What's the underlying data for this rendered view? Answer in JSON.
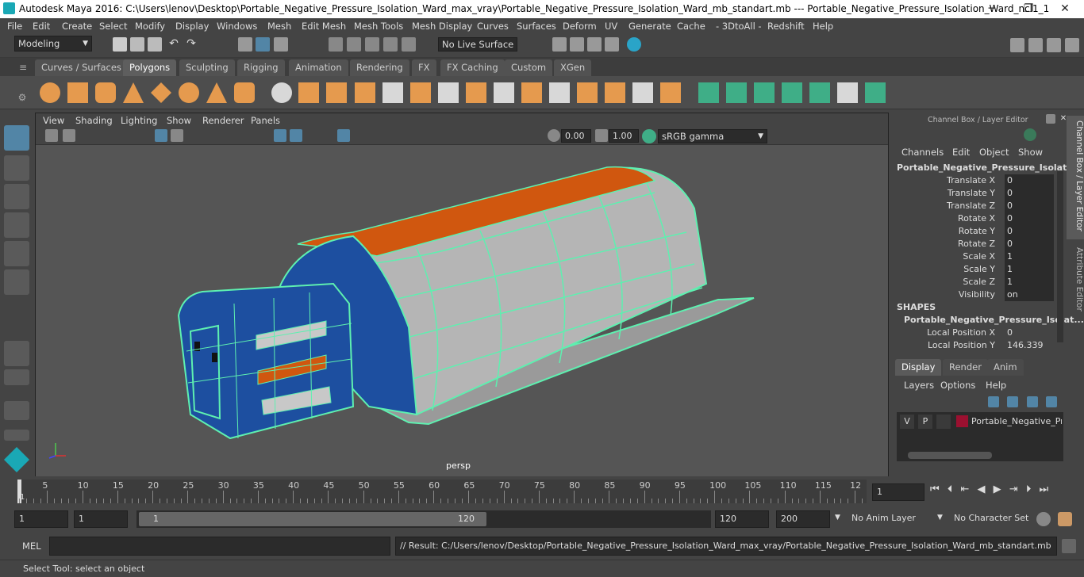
{
  "title": "Autodesk Maya 2016: C:\\Users\\lenov\\Desktop\\Portable_Negative_Pressure_Isolation_Ward_max_vray\\Portable_Negative_Pressure_Isolation_Ward_mb_standart.mb   ---   Portable_Negative_Pressure_Isolation_Ward_ncl1_1",
  "window": {
    "minimize": "─",
    "maximize": "❐",
    "close": "✕"
  },
  "menu": [
    "File",
    "Edit",
    "Create",
    "Select",
    "Modify",
    "Display",
    "Windows",
    "Mesh",
    "Edit Mesh",
    "Mesh Tools",
    "Mesh Display",
    "Curves",
    "Surfaces",
    "Deform",
    "UV",
    "Generate",
    "Cache",
    "- 3DtoAll -",
    "Redshift",
    "Help"
  ],
  "status": {
    "mode": "Modeling",
    "live_surface": "No Live Surface"
  },
  "shelf_tabs": [
    "Curves / Surfaces",
    "Polygons",
    "Sculpting",
    "Rigging",
    "Animation",
    "Rendering",
    "FX",
    "FX Caching",
    "Custom",
    "XGen"
  ],
  "active_shelf": "Polygons",
  "viewport": {
    "menu": [
      "View",
      "Shading",
      "Lighting",
      "Show",
      "Renderer",
      "Panels"
    ],
    "exposure": "0.00",
    "gamma": "1.00",
    "colorspace": "sRGB gamma",
    "camera": "persp"
  },
  "channel_box": {
    "header": "Channel Box / Layer Editor",
    "menu": [
      "Channels",
      "Edit",
      "Object",
      "Show"
    ],
    "object_name": "Portable_Negative_Pressure_Isolati...",
    "attributes": [
      {
        "label": "Translate X",
        "value": "0"
      },
      {
        "label": "Translate Y",
        "value": "0"
      },
      {
        "label": "Translate Z",
        "value": "0"
      },
      {
        "label": "Rotate X",
        "value": "0"
      },
      {
        "label": "Rotate Y",
        "value": "0"
      },
      {
        "label": "Rotate Z",
        "value": "0"
      },
      {
        "label": "Scale X",
        "value": "1"
      },
      {
        "label": "Scale Y",
        "value": "1"
      },
      {
        "label": "Scale Z",
        "value": "1"
      },
      {
        "label": "Visibility",
        "value": "on"
      }
    ],
    "shapes_label": "SHAPES",
    "shape_name": "Portable_Negative_Pressure_Isolat...",
    "shape_attrs": [
      {
        "label": "Local Position X",
        "value": "0"
      },
      {
        "label": "Local Position Y",
        "value": "146.339"
      }
    ],
    "side_tabs": [
      "Channel Box / Layer Editor",
      "Attribute Editor"
    ]
  },
  "layer_editor": {
    "tabs": [
      "Display",
      "Render",
      "Anim"
    ],
    "menu": [
      "Layers",
      "Options",
      "Help"
    ],
    "layer": {
      "v": "V",
      "p": "P",
      "name": "Portable_Negative_Pre",
      "color": "#9b1030"
    }
  },
  "timeline": {
    "ticks": [
      "5",
      "10",
      "15",
      "20",
      "25",
      "30",
      "35",
      "40",
      "45",
      "50",
      "55",
      "60",
      "65",
      "70",
      "75",
      "80",
      "85",
      "90",
      "95",
      "100",
      "105",
      "110",
      "115",
      "12"
    ],
    "start_mark": "1",
    "current_frame": "1"
  },
  "range": {
    "start": "1",
    "start2": "1",
    "slider_start": "1",
    "slider_end": "120",
    "end": "120",
    "end2": "200",
    "anim_layer": "No Anim Layer",
    "char_set": "No Character Set"
  },
  "command": {
    "lang": "MEL",
    "result": "// Result: C:/Users/lenov/Desktop/Portable_Negative_Pressure_Isolation_Ward_max_vray/Portable_Negative_Pressure_Isolation_Ward_mb_standart.mb"
  },
  "help_text": "Select Tool: select an object",
  "colors": {
    "accent": "#5285a6",
    "wire": "#5ef0b0",
    "orange": "#d0570f",
    "blue": "#1d4fa0",
    "shelf_orange": "#e59a4e"
  }
}
